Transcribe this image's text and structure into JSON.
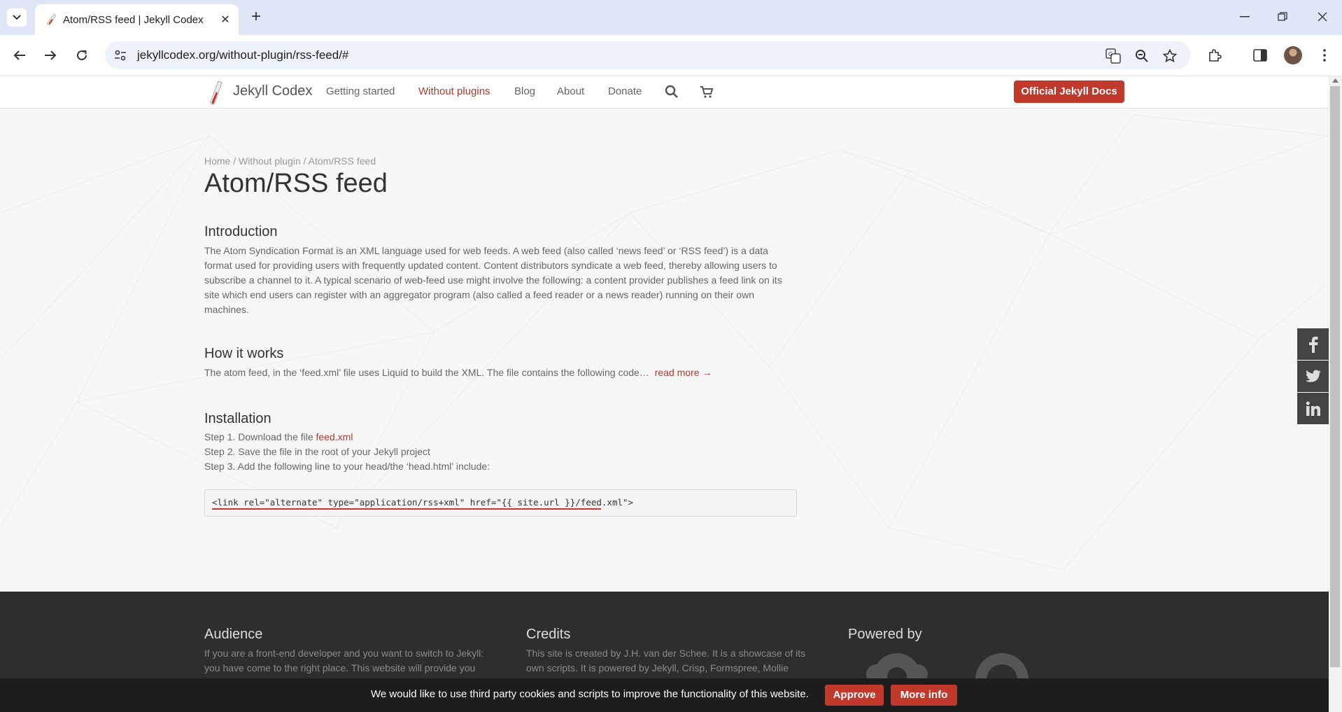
{
  "browser": {
    "tab_title": "Atom/RSS feed | Jekyll Codex",
    "url": "jekyllcodex.org/without-plugin/rss-feed/#"
  },
  "site": {
    "brand": "Jekyll Codex",
    "nav": [
      "Getting started",
      "Without plugins",
      "Blog",
      "About",
      "Donate"
    ],
    "active_nav": "Without plugins",
    "cta": "Official Jekyll Docs"
  },
  "page": {
    "breadcrumb": "Home / Without plugin / Atom/RSS feed",
    "title": "Atom/RSS feed",
    "intro_heading": "Introduction",
    "intro_text": "The Atom Syndication Format is an XML language used for web feeds. A web feed (also called ‘news feed’ or ‘RSS feed’) is a data format used for providing users with frequently updated content. Content distributors syndicate a web feed, thereby allowing users to subscribe a channel to it. A typical scenario of web-feed use might involve the following: a content provider publishes a feed link on its site which end users can register with an aggregator program (also called a feed reader or a news reader) running on their own machines.",
    "how_heading": "How it works",
    "how_text": "The atom feed, in the ‘feed.xml’ file uses Liquid to build the XML. The file contains the following code…",
    "read_more": "read more →",
    "install_heading": "Installation",
    "step1_prefix": "Step 1. Download the file ",
    "step1_link": "feed.xml",
    "step2": "Step 2. Save the file in the root of your Jekyll project",
    "step3": "Step 3. Add the following line to your head/the ‘head.html’ include:",
    "code": "<link rel=\"alternate\" type=\"application/rss+xml\" href=\"{{ site.url }}/feed.xml\">"
  },
  "footer": {
    "audience_title": "Audience",
    "audience_text": "If you are a front-end developer and you want to switch to Jekyll: you have come to the right place. This website will provide you with some valuable resources.",
    "credits_title": "Credits",
    "credits_text": "This site is created by J.H. van der Schee. It is a showcase of its own scripts. It is powered by Jekyll, Crisp, Formspree, Mollie and CloudCannon and is hosted on CloudCannon.",
    "powered_title": "Powered by"
  },
  "cookie": {
    "text": "We would like to use third party cookies and scripts to improve the functionality of this website.",
    "approve": "Approve",
    "more_info": "More info"
  },
  "colors": {
    "accent": "#c0392b",
    "footer": "#2e2e2e"
  }
}
